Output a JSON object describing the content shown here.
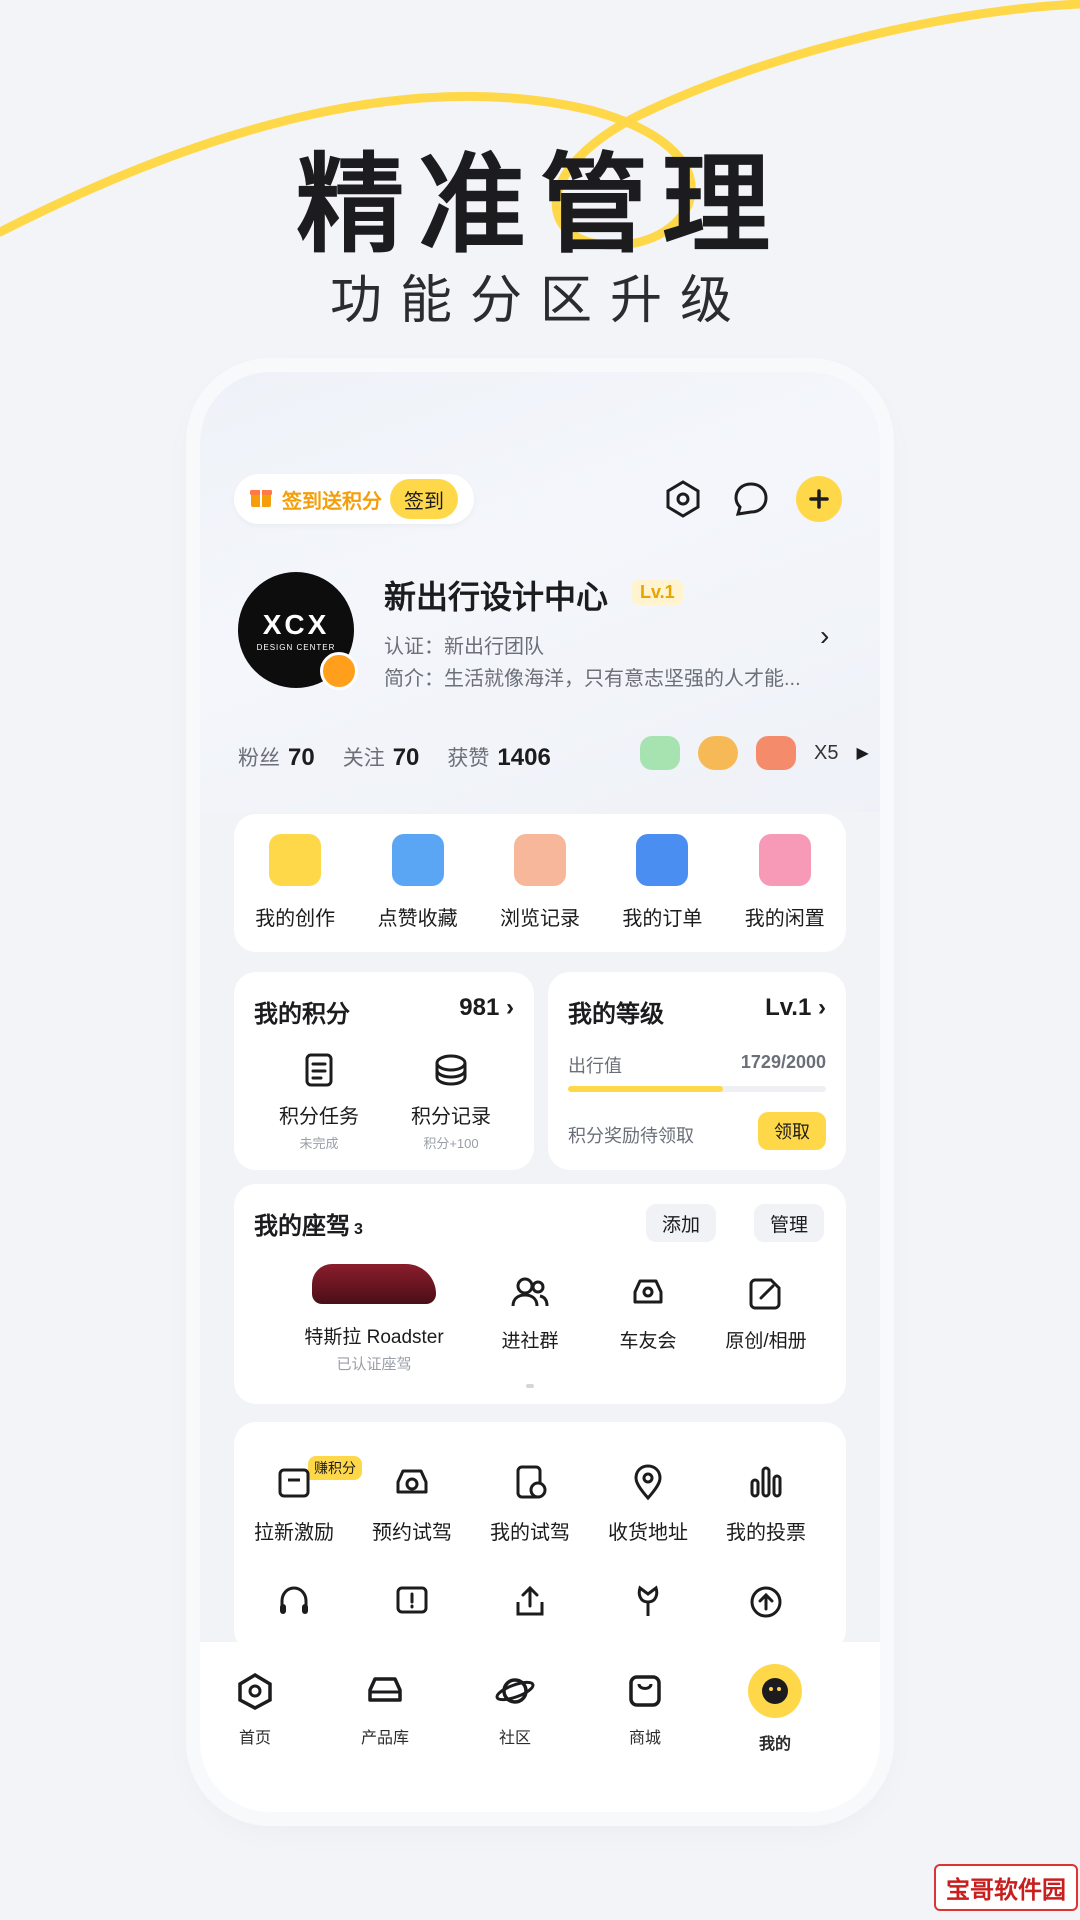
{
  "hero": {
    "title": "精准管理",
    "subtitle": "功能分区升级"
  },
  "topbar": {
    "checkin_text": "签到送积分",
    "checkin_button": "签到"
  },
  "profile": {
    "name": "新出行设计中心",
    "level": "Lv.1",
    "certification": "认证：新出行团队",
    "bio": "简介：生活就像海洋，只有意志坚强的人才能...",
    "avatar_logo": "XCX",
    "avatar_sub": "DESIGN CENTER"
  },
  "stats": [
    {
      "label": "粉丝",
      "value": "70"
    },
    {
      "label": "关注",
      "value": "70"
    },
    {
      "label": "获赞",
      "value": "1406"
    }
  ],
  "badges": {
    "count_label": "X5"
  },
  "quick": [
    {
      "label": "我的创作",
      "color": "#ffd84a"
    },
    {
      "label": "点赞收藏",
      "color": "#5aa6f4"
    },
    {
      "label": "浏览记录",
      "color": "#f7b79a"
    },
    {
      "label": "我的订单",
      "color": "#4b8ef1"
    },
    {
      "label": "我的闲置",
      "color": "#f79ab8"
    }
  ],
  "points": {
    "title": "我的积分",
    "value": "981",
    "items": [
      {
        "label": "积分任务",
        "sub": "未完成"
      },
      {
        "label": "积分记录",
        "sub": "积分+100"
      }
    ]
  },
  "level_card": {
    "title": "我的等级",
    "value": "Lv.1",
    "progress_label": "出行值",
    "progress_text": "1729/2000",
    "progress_fraction": 0.6,
    "reward_text": "积分奖励待领取",
    "reward_button": "领取"
  },
  "seats": {
    "title": "我的座驾",
    "count": "3",
    "add_button": "添加",
    "manage_button": "管理",
    "car_name": "特斯拉 Roadster",
    "car_status": "已认证座驾",
    "items": [
      "进社群",
      "车友会",
      "原创/相册"
    ]
  },
  "services": {
    "earn_tag": "赚积分",
    "row1": [
      "拉新激励",
      "预约试驾",
      "我的试驾",
      "收货地址",
      "我的投票"
    ]
  },
  "tabs": [
    {
      "label": "首页"
    },
    {
      "label": "产品库"
    },
    {
      "label": "社区"
    },
    {
      "label": "商城"
    },
    {
      "label": "我的"
    }
  ],
  "watermark": "宝哥软件园",
  "colors": {
    "accent": "#ffd84a",
    "text": "#1c1c1e",
    "muted": "#6b6f78"
  }
}
